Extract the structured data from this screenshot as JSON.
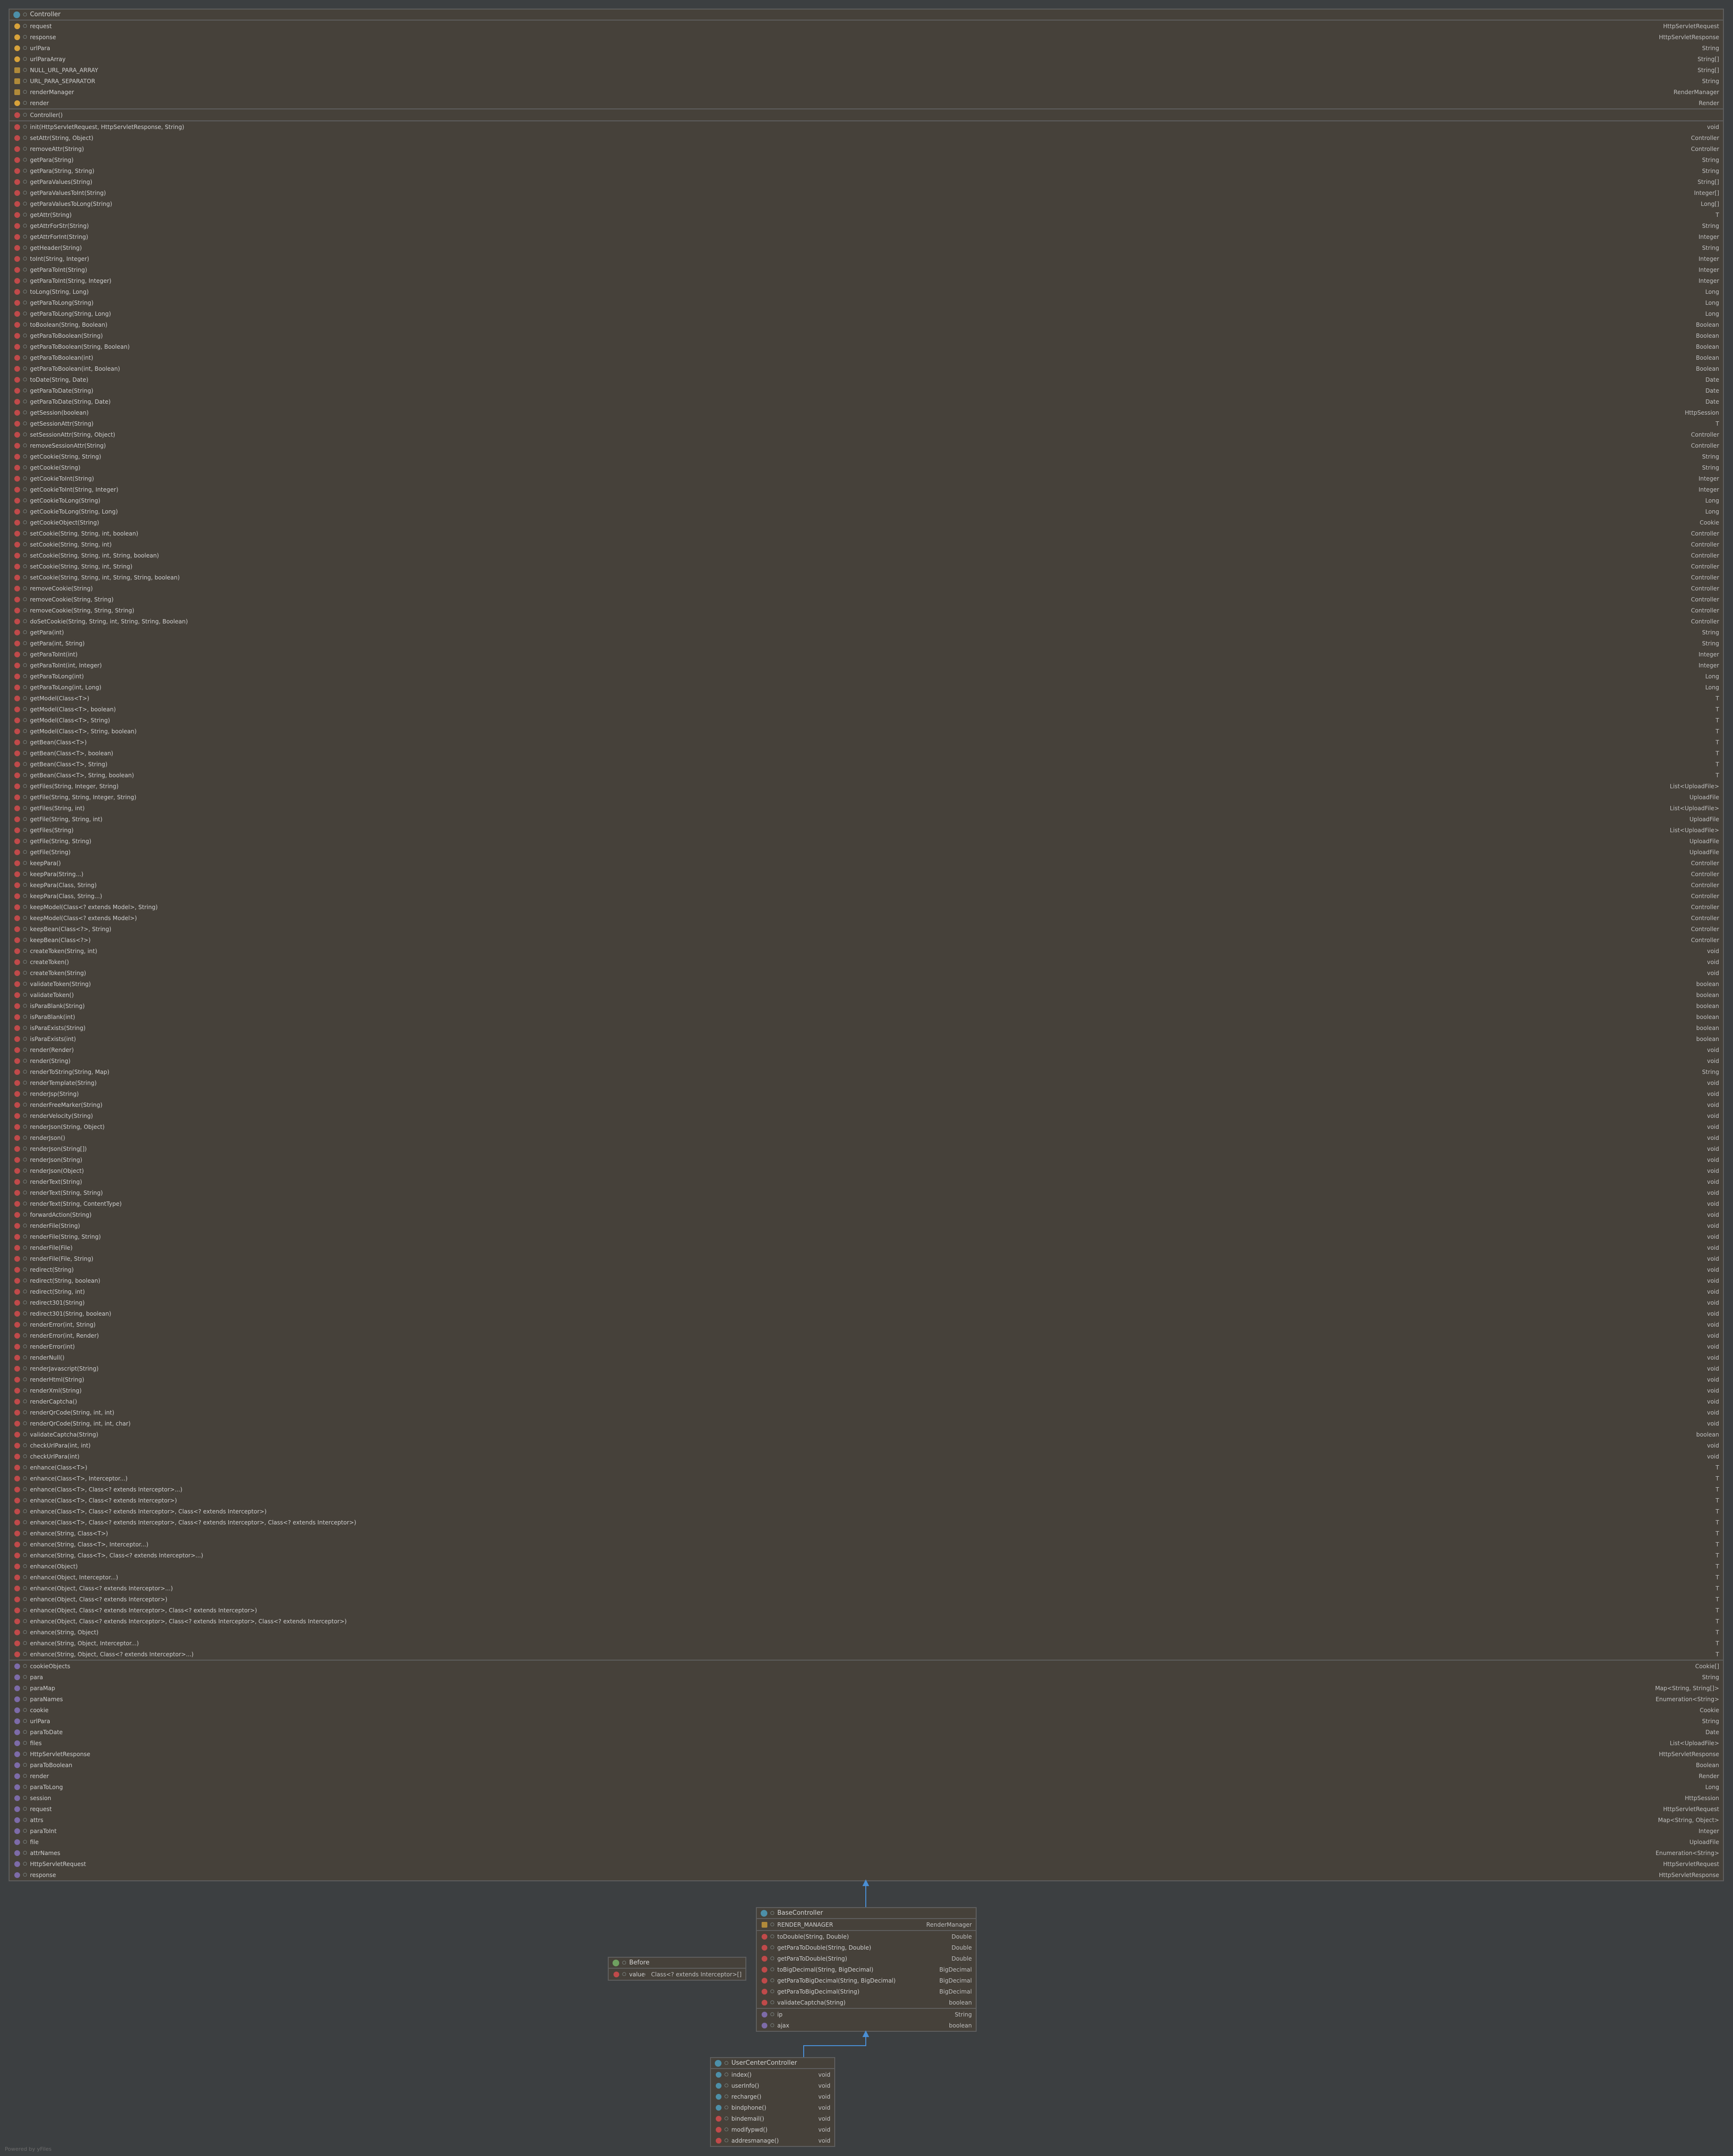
{
  "controller": {
    "title": "Controller",
    "fields": [
      {
        "kind": "field",
        "name": "request",
        "type": "HttpServletRequest"
      },
      {
        "kind": "field",
        "name": "response",
        "type": "HttpServletResponse"
      },
      {
        "kind": "field",
        "name": "urlPara",
        "type": "String"
      },
      {
        "kind": "field",
        "name": "urlParaArray",
        "type": "String[]"
      },
      {
        "kind": "const",
        "name": "NULL_URL_PARA_ARRAY",
        "type": "String[]"
      },
      {
        "kind": "const",
        "name": "URL_PARA_SEPARATOR",
        "type": "String"
      },
      {
        "kind": "const",
        "name": "renderManager",
        "type": "RenderManager"
      },
      {
        "kind": "field",
        "name": "render",
        "type": "Render"
      }
    ],
    "constructors": [
      {
        "kind": "ctor",
        "name": "Controller()",
        "type": ""
      }
    ],
    "methods": [
      {
        "name": "init(HttpServletRequest, HttpServletResponse, String)",
        "type": "void"
      },
      {
        "name": "setAttr(String, Object)",
        "type": "Controller"
      },
      {
        "name": "removeAttr(String)",
        "type": "Controller"
      },
      {
        "name": "getPara(String)",
        "type": "String"
      },
      {
        "name": "getPara(String, String)",
        "type": "String"
      },
      {
        "name": "getParaValues(String)",
        "type": "String[]"
      },
      {
        "name": "getParaValuesToInt(String)",
        "type": "Integer[]"
      },
      {
        "name": "getParaValuesToLong(String)",
        "type": "Long[]"
      },
      {
        "name": "getAttr(String)",
        "type": "T"
      },
      {
        "name": "getAttrForStr(String)",
        "type": "String"
      },
      {
        "name": "getAttrForInt(String)",
        "type": "Integer"
      },
      {
        "name": "getHeader(String)",
        "type": "String"
      },
      {
        "name": "toInt(String, Integer)",
        "type": "Integer"
      },
      {
        "name": "getParaToInt(String)",
        "type": "Integer"
      },
      {
        "name": "getParaToInt(String, Integer)",
        "type": "Integer"
      },
      {
        "name": "toLong(String, Long)",
        "type": "Long"
      },
      {
        "name": "getParaToLong(String)",
        "type": "Long"
      },
      {
        "name": "getParaToLong(String, Long)",
        "type": "Long"
      },
      {
        "name": "toBoolean(String, Boolean)",
        "type": "Boolean"
      },
      {
        "name": "getParaToBoolean(String)",
        "type": "Boolean"
      },
      {
        "name": "getParaToBoolean(String, Boolean)",
        "type": "Boolean"
      },
      {
        "name": "getParaToBoolean(int)",
        "type": "Boolean"
      },
      {
        "name": "getParaToBoolean(int, Boolean)",
        "type": "Boolean"
      },
      {
        "name": "toDate(String, Date)",
        "type": "Date"
      },
      {
        "name": "getParaToDate(String)",
        "type": "Date"
      },
      {
        "name": "getParaToDate(String, Date)",
        "type": "Date"
      },
      {
        "name": "getSession(boolean)",
        "type": "HttpSession"
      },
      {
        "name": "getSessionAttr(String)",
        "type": "T"
      },
      {
        "name": "setSessionAttr(String, Object)",
        "type": "Controller"
      },
      {
        "name": "removeSessionAttr(String)",
        "type": "Controller"
      },
      {
        "name": "getCookie(String, String)",
        "type": "String"
      },
      {
        "name": "getCookie(String)",
        "type": "String"
      },
      {
        "name": "getCookieToInt(String)",
        "type": "Integer"
      },
      {
        "name": "getCookieToInt(String, Integer)",
        "type": "Integer"
      },
      {
        "name": "getCookieToLong(String)",
        "type": "Long"
      },
      {
        "name": "getCookieToLong(String, Long)",
        "type": "Long"
      },
      {
        "name": "getCookieObject(String)",
        "type": "Cookie"
      },
      {
        "name": "setCookie(String, String, int, boolean)",
        "type": "Controller"
      },
      {
        "name": "setCookie(String, String, int)",
        "type": "Controller"
      },
      {
        "name": "setCookie(String, String, int, String, boolean)",
        "type": "Controller"
      },
      {
        "name": "setCookie(String, String, int, String)",
        "type": "Controller"
      },
      {
        "name": "setCookie(String, String, int, String, String, boolean)",
        "type": "Controller"
      },
      {
        "name": "removeCookie(String)",
        "type": "Controller"
      },
      {
        "name": "removeCookie(String, String)",
        "type": "Controller"
      },
      {
        "name": "removeCookie(String, String, String)",
        "type": "Controller"
      },
      {
        "name": "doSetCookie(String, String, int, String, String, Boolean)",
        "type": "Controller"
      },
      {
        "name": "getPara(int)",
        "type": "String"
      },
      {
        "name": "getPara(int, String)",
        "type": "String"
      },
      {
        "name": "getParaToInt(int)",
        "type": "Integer"
      },
      {
        "name": "getParaToInt(int, Integer)",
        "type": "Integer"
      },
      {
        "name": "getParaToLong(int)",
        "type": "Long"
      },
      {
        "name": "getParaToLong(int, Long)",
        "type": "Long"
      },
      {
        "name": "getModel(Class<T>)",
        "type": "T"
      },
      {
        "name": "getModel(Class<T>, boolean)",
        "type": "T"
      },
      {
        "name": "getModel(Class<T>, String)",
        "type": "T"
      },
      {
        "name": "getModel(Class<T>, String, boolean)",
        "type": "T"
      },
      {
        "name": "getBean(Class<T>)",
        "type": "T"
      },
      {
        "name": "getBean(Class<T>, boolean)",
        "type": "T"
      },
      {
        "name": "getBean(Class<T>, String)",
        "type": "T"
      },
      {
        "name": "getBean(Class<T>, String, boolean)",
        "type": "T"
      },
      {
        "name": "getFiles(String, Integer, String)",
        "type": "List<UploadFile>"
      },
      {
        "name": "getFile(String, String, Integer, String)",
        "type": "UploadFile"
      },
      {
        "name": "getFiles(String, int)",
        "type": "List<UploadFile>"
      },
      {
        "name": "getFile(String, String, int)",
        "type": "UploadFile"
      },
      {
        "name": "getFiles(String)",
        "type": "List<UploadFile>"
      },
      {
        "name": "getFile(String, String)",
        "type": "UploadFile"
      },
      {
        "name": "getFile(String)",
        "type": "UploadFile"
      },
      {
        "name": "keepPara()",
        "type": "Controller"
      },
      {
        "name": "keepPara(String...)",
        "type": "Controller"
      },
      {
        "name": "keepPara(Class, String)",
        "type": "Controller"
      },
      {
        "name": "keepPara(Class, String...)",
        "type": "Controller"
      },
      {
        "name": "keepModel(Class<? extends Model>, String)",
        "type": "Controller"
      },
      {
        "name": "keepModel(Class<? extends Model>)",
        "type": "Controller"
      },
      {
        "name": "keepBean(Class<?>, String)",
        "type": "Controller"
      },
      {
        "name": "keepBean(Class<?>)",
        "type": "Controller"
      },
      {
        "name": "createToken(String, int)",
        "type": "void"
      },
      {
        "name": "createToken()",
        "type": "void"
      },
      {
        "name": "createToken(String)",
        "type": "void"
      },
      {
        "name": "validateToken(String)",
        "type": "boolean"
      },
      {
        "name": "validateToken()",
        "type": "boolean"
      },
      {
        "name": "isParaBlank(String)",
        "type": "boolean"
      },
      {
        "name": "isParaBlank(int)",
        "type": "boolean"
      },
      {
        "name": "isParaExists(String)",
        "type": "boolean"
      },
      {
        "name": "isParaExists(int)",
        "type": "boolean"
      },
      {
        "name": "render(Render)",
        "type": "void"
      },
      {
        "name": "render(String)",
        "type": "void"
      },
      {
        "name": "renderToString(String, Map)",
        "type": "String"
      },
      {
        "name": "renderTemplate(String)",
        "type": "void"
      },
      {
        "name": "renderJsp(String)",
        "type": "void"
      },
      {
        "name": "renderFreeMarker(String)",
        "type": "void"
      },
      {
        "name": "renderVelocity(String)",
        "type": "void"
      },
      {
        "name": "renderJson(String, Object)",
        "type": "void"
      },
      {
        "name": "renderJson()",
        "type": "void"
      },
      {
        "name": "renderJson(String[])",
        "type": "void"
      },
      {
        "name": "renderJson(String)",
        "type": "void"
      },
      {
        "name": "renderJson(Object)",
        "type": "void"
      },
      {
        "name": "renderText(String)",
        "type": "void"
      },
      {
        "name": "renderText(String, String)",
        "type": "void"
      },
      {
        "name": "renderText(String, ContentType)",
        "type": "void"
      },
      {
        "name": "forwardAction(String)",
        "type": "void"
      },
      {
        "name": "renderFile(String)",
        "type": "void"
      },
      {
        "name": "renderFile(String, String)",
        "type": "void"
      },
      {
        "name": "renderFile(File)",
        "type": "void"
      },
      {
        "name": "renderFile(File, String)",
        "type": "void"
      },
      {
        "name": "redirect(String)",
        "type": "void"
      },
      {
        "name": "redirect(String, boolean)",
        "type": "void"
      },
      {
        "name": "redirect(String, int)",
        "type": "void"
      },
      {
        "name": "redirect301(String)",
        "type": "void"
      },
      {
        "name": "redirect301(String, boolean)",
        "type": "void"
      },
      {
        "name": "renderError(int, String)",
        "type": "void"
      },
      {
        "name": "renderError(int, Render)",
        "type": "void"
      },
      {
        "name": "renderError(int)",
        "type": "void"
      },
      {
        "name": "renderNull()",
        "type": "void"
      },
      {
        "name": "renderJavascript(String)",
        "type": "void"
      },
      {
        "name": "renderHtml(String)",
        "type": "void"
      },
      {
        "name": "renderXml(String)",
        "type": "void"
      },
      {
        "name": "renderCaptcha()",
        "type": "void"
      },
      {
        "name": "renderQrCode(String, int, int)",
        "type": "void"
      },
      {
        "name": "renderQrCode(String, int, int, char)",
        "type": "void"
      },
      {
        "name": "validateCaptcha(String)",
        "type": "boolean"
      },
      {
        "name": "checkUrlPara(int, int)",
        "type": "void"
      },
      {
        "name": "checkUrlPara(int)",
        "type": "void"
      },
      {
        "name": "enhance(Class<T>)",
        "type": "T"
      },
      {
        "name": "enhance(Class<T>, Interceptor...)",
        "type": "T"
      },
      {
        "name": "enhance(Class<T>, Class<? extends Interceptor>...)",
        "type": "T"
      },
      {
        "name": "enhance(Class<T>, Class<? extends Interceptor>)",
        "type": "T"
      },
      {
        "name": "enhance(Class<T>, Class<? extends Interceptor>, Class<? extends Interceptor>)",
        "type": "T"
      },
      {
        "name": "enhance(Class<T>, Class<? extends Interceptor>, Class<? extends Interceptor>, Class<? extends Interceptor>)",
        "type": "T"
      },
      {
        "name": "enhance(String, Class<T>)",
        "type": "T"
      },
      {
        "name": "enhance(String, Class<T>, Interceptor...)",
        "type": "T"
      },
      {
        "name": "enhance(String, Class<T>, Class<? extends Interceptor>...)",
        "type": "T"
      },
      {
        "name": "enhance(Object)",
        "type": "T"
      },
      {
        "name": "enhance(Object, Interceptor...)",
        "type": "T"
      },
      {
        "name": "enhance(Object, Class<? extends Interceptor>...)",
        "type": "T"
      },
      {
        "name": "enhance(Object, Class<? extends Interceptor>)",
        "type": "T"
      },
      {
        "name": "enhance(Object, Class<? extends Interceptor>, Class<? extends Interceptor>)",
        "type": "T"
      },
      {
        "name": "enhance(Object, Class<? extends Interceptor>, Class<? extends Interceptor>, Class<? extends Interceptor>)",
        "type": "T"
      },
      {
        "name": "enhance(String, Object)",
        "type": "T"
      },
      {
        "name": "enhance(String, Object, Interceptor...)",
        "type": "T"
      },
      {
        "name": "enhance(String, Object, Class<? extends Interceptor>...)",
        "type": "T"
      }
    ],
    "properties": [
      {
        "name": "cookieObjects",
        "type": "Cookie[]"
      },
      {
        "name": "para",
        "type": "String"
      },
      {
        "name": "paraMap",
        "type": "Map<String, String[]>"
      },
      {
        "name": "paraNames",
        "type": "Enumeration<String>"
      },
      {
        "name": "cookie",
        "type": "Cookie"
      },
      {
        "name": "urlPara",
        "type": "String"
      },
      {
        "name": "paraToDate",
        "type": "Date"
      },
      {
        "name": "files",
        "type": "List<UploadFile>"
      },
      {
        "name": "HttpServletResponse",
        "type": "HttpServletResponse"
      },
      {
        "name": "paraToBoolean",
        "type": "Boolean"
      },
      {
        "name": "render",
        "type": "Render"
      },
      {
        "name": "paraToLong",
        "type": "Long"
      },
      {
        "name": "session",
        "type": "HttpSession"
      },
      {
        "name": "request",
        "type": "HttpServletRequest"
      },
      {
        "name": "attrs",
        "type": "Map<String, Object>"
      },
      {
        "name": "paraToInt",
        "type": "Integer"
      },
      {
        "name": "file",
        "type": "UploadFile"
      },
      {
        "name": "attrNames",
        "type": "Enumeration<String>"
      },
      {
        "name": "HttpServletRequest",
        "type": "HttpServletRequest"
      },
      {
        "name": "response",
        "type": "HttpServletResponse"
      }
    ]
  },
  "base_controller": {
    "title": "BaseController",
    "fields": [
      {
        "kind": "const",
        "name": "RENDER_MANAGER",
        "type": "RenderManager"
      }
    ],
    "methods": [
      {
        "name": "toDouble(String, Double)",
        "type": "Double"
      },
      {
        "name": "getParaToDouble(String, Double)",
        "type": "Double"
      },
      {
        "name": "getParaToDouble(String)",
        "type": "Double"
      },
      {
        "name": "toBigDecimal(String, BigDecimal)",
        "type": "BigDecimal"
      },
      {
        "name": "getParaToBigDecimal(String, BigDecimal)",
        "type": "BigDecimal"
      },
      {
        "name": "getParaToBigDecimal(String)",
        "type": "BigDecimal"
      },
      {
        "name": "validateCaptcha(String)",
        "type": "boolean"
      }
    ],
    "properties": [
      {
        "name": "ip",
        "type": "String"
      },
      {
        "name": "ajax",
        "type": "boolean"
      }
    ]
  },
  "before": {
    "title": "Before",
    "methods": [
      {
        "name": "value()",
        "type": "Class<? extends Interceptor>[]"
      }
    ]
  },
  "user_center_controller": {
    "title": "UserCenterController",
    "methods": [
      {
        "kind": "web",
        "name": "index()",
        "type": "void"
      },
      {
        "kind": "web",
        "name": "userInfo()",
        "type": "void"
      },
      {
        "kind": "web",
        "name": "recharge()",
        "type": "void"
      },
      {
        "kind": "web",
        "name": "bindphone()",
        "type": "void"
      },
      {
        "kind": "method",
        "name": "bindemail()",
        "type": "void"
      },
      {
        "kind": "method",
        "name": "modifypwd()",
        "type": "void"
      },
      {
        "kind": "method",
        "name": "addresmanage()",
        "type": "void"
      }
    ]
  },
  "footer": "Powered by yFiles",
  "colors": {
    "background": "#3c3f41",
    "box_fill": "#46413a",
    "border": "#5e5e5e",
    "arrow": "#4a8ed4"
  }
}
